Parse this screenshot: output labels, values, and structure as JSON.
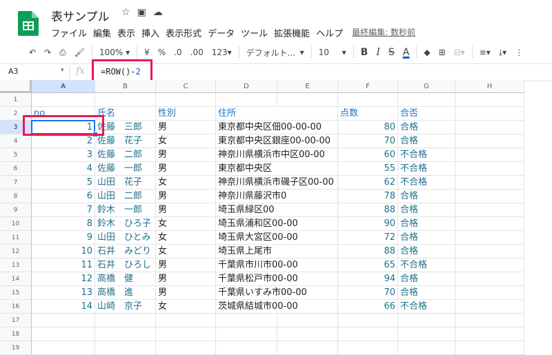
{
  "app": {
    "title": "表サンプル",
    "menu": [
      "ファイル",
      "編集",
      "表示",
      "挿入",
      "表示形式",
      "データ",
      "ツール",
      "拡張機能",
      "ヘルプ"
    ],
    "last_edit": "最終編集: 数秒前",
    "accent": "#0F9D58"
  },
  "toolbar": {
    "zoom": "100%",
    "currency": "¥",
    "percent": "%",
    "dec_less": ".0",
    "dec_more": ".00",
    "format_123": "123",
    "font": "デフォルト...",
    "font_size": "10",
    "bold": "B",
    "italic": "I",
    "strike": "S",
    "text_color": "A"
  },
  "formula_bar": {
    "cell_ref": "A3",
    "fx": "fx",
    "formula_prefix": "=ROW()-",
    "formula_num": "2"
  },
  "grid": {
    "columns": [
      "A",
      "B",
      "C",
      "D",
      "E",
      "F",
      "G",
      "H"
    ],
    "rows": [
      "1",
      "2",
      "3",
      "4",
      "5",
      "6",
      "7",
      "8",
      "9",
      "10",
      "11",
      "12",
      "13",
      "14",
      "15",
      "16",
      "17",
      "18",
      "19"
    ],
    "header_row": {
      "no": "no",
      "name": "氏名",
      "gender": "性別",
      "address": "住所",
      "score": "点数",
      "result": "合否"
    },
    "records": [
      {
        "no": "1",
        "name": "佐藤　三郎",
        "gender": "男",
        "address": "東京都中央区佃00-00-00",
        "score": "80",
        "result": "合格"
      },
      {
        "no": "2",
        "name": "佐藤　花子",
        "gender": "女",
        "address": "東京都中央区銀座00-00-00",
        "score": "70",
        "result": "合格"
      },
      {
        "no": "3",
        "name": "佐藤　二郎",
        "gender": "男",
        "address": "神奈川県横浜市中区00-00",
        "score": "60",
        "result": "不合格"
      },
      {
        "no": "4",
        "name": "佐藤　一郎",
        "gender": "男",
        "address": "東京都中央区",
        "score": "55",
        "result": "不合格"
      },
      {
        "no": "5",
        "name": "山田　花子",
        "gender": "女",
        "address": "神奈川県横浜市磯子区00-00",
        "score": "62",
        "result": "不合格"
      },
      {
        "no": "6",
        "name": "山田　二郎",
        "gender": "男",
        "address": "神奈川県藤沢市0",
        "score": "78",
        "result": "合格"
      },
      {
        "no": "7",
        "name": "鈴木　一郎",
        "gender": "男",
        "address": "埼玉県緑区00",
        "score": "88",
        "result": "合格"
      },
      {
        "no": "8",
        "name": "鈴木　ひろ子",
        "gender": "女",
        "address": "埼玉県浦和区00-00",
        "score": "90",
        "result": "合格"
      },
      {
        "no": "9",
        "name": "山田　ひとみ",
        "gender": "女",
        "address": "埼玉県大宮区00-00",
        "score": "72",
        "result": "合格"
      },
      {
        "no": "10",
        "name": "石井　みどり",
        "gender": "女",
        "address": "埼玉県上尾市",
        "score": "88",
        "result": "合格"
      },
      {
        "no": "11",
        "name": "石井　ひろし",
        "gender": "男",
        "address": "千葉県市川市00-00",
        "score": "65",
        "result": "不合格"
      },
      {
        "no": "12",
        "name": "高橋　健",
        "gender": "男",
        "address": "千葉県松戸市00-00",
        "score": "94",
        "result": "合格"
      },
      {
        "no": "13",
        "name": "高橋　進",
        "gender": "男",
        "address": "千葉県いすみ市00-00",
        "score": "70",
        "result": "合格"
      },
      {
        "no": "14",
        "name": "山崎　京子",
        "gender": "女",
        "address": "茨城県結城市00-00",
        "score": "66",
        "result": "不合格"
      }
    ]
  },
  "highlight_color": "#E8194F"
}
